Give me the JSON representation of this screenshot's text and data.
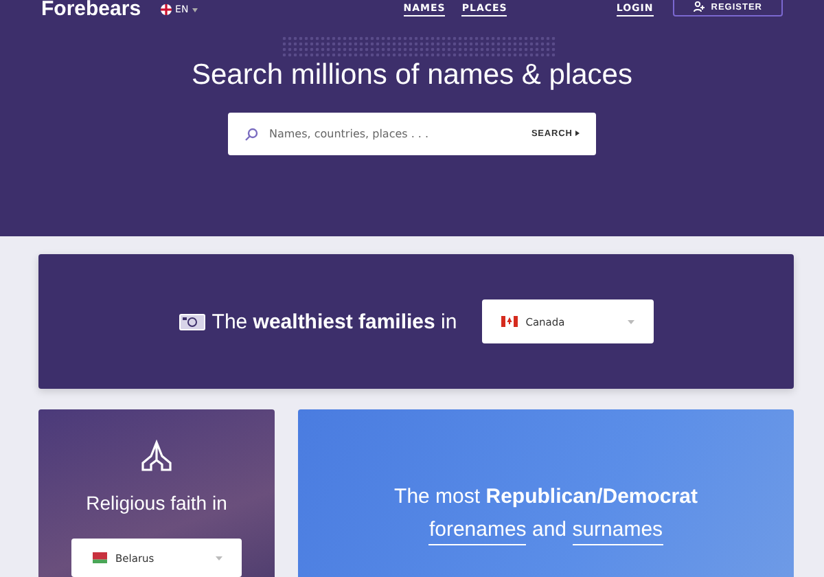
{
  "header": {
    "logo": "Forebears",
    "language": "EN",
    "nav": [
      "NAMES",
      "PLACES"
    ],
    "login": "LOGIN",
    "register": "REGISTER"
  },
  "hero": {
    "title": "Search millions of names & places",
    "search": {
      "placeholder": "Names, countries, places . . .",
      "button": "SEARCH"
    }
  },
  "wealth_card": {
    "text": "The **wealthiest families** in",
    "country": "Canada"
  },
  "faith_card": {
    "text": "Religious faith in",
    "country": "Belarus"
  },
  "politics_card": {
    "lead": "The most **Republican/Democrat**",
    "link_1": "forenames",
    "joiner": "and",
    "link_2": "surnames"
  }
}
